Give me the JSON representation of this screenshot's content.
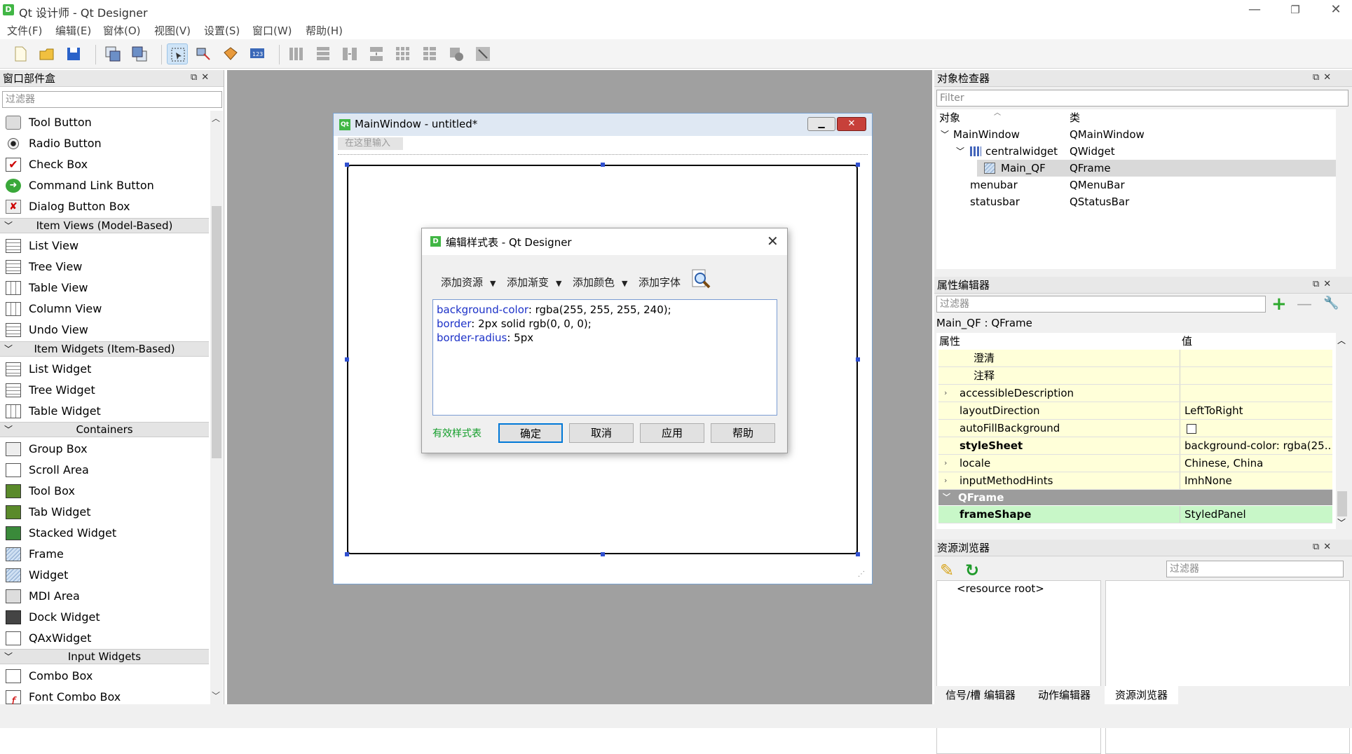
{
  "app": {
    "title": "Qt 设计师 - Qt Designer",
    "icon_letter": "D"
  },
  "window_controls": {
    "minimize": "—",
    "restore": "❐",
    "close": "✕"
  },
  "menus": [
    "文件(F)",
    "编辑(E)",
    "窗体(O)",
    "视图(V)",
    "设置(S)",
    "窗口(W)",
    "帮助(H)"
  ],
  "widget_box": {
    "title": "窗口部件盒",
    "filter_placeholder": "过滤器",
    "items_buttons": [
      "Tool Button",
      "Radio Button",
      "Check Box",
      "Command Link Button",
      "Dialog Button Box"
    ],
    "cat_item_views": "Item Views (Model-Based)",
    "items_views": [
      "List View",
      "Tree View",
      "Table View",
      "Column View",
      "Undo View"
    ],
    "cat_item_widgets": "Item Widgets (Item-Based)",
    "items_widgets": [
      "List Widget",
      "Tree Widget",
      "Table Widget"
    ],
    "cat_containers": "Containers",
    "items_containers": [
      "Group Box",
      "Scroll Area",
      "Tool Box",
      "Tab Widget",
      "Stacked Widget",
      "Frame",
      "Widget",
      "MDI Area",
      "Dock Widget",
      "QAxWidget"
    ],
    "cat_input": "Input Widgets",
    "items_input": [
      "Combo Box",
      "Font Combo Box"
    ]
  },
  "form": {
    "title": "MainWindow - untitled*",
    "qt_badge": "Qt",
    "menu_placeholder": "在这里输入"
  },
  "dialog": {
    "title": "编辑样式表 - Qt Designer",
    "add_resource": "添加资源",
    "add_gradient": "添加渐变",
    "add_color": "添加颜色",
    "add_font": "添加字体",
    "css": [
      {
        "prop": "background-color",
        "value": ": rgba(255, 255, 255, 240);"
      },
      {
        "prop": "border",
        "value": ": 2px solid rgb(0, 0, 0);"
      },
      {
        "prop": "border-radius",
        "value": ": 5px"
      }
    ],
    "valid_text": "有效样式表",
    "ok": "确定",
    "cancel": "取消",
    "apply": "应用",
    "help": "帮助"
  },
  "object_inspector": {
    "title": "对象检查器",
    "filter_placeholder": "Filter",
    "col_object": "对象",
    "col_class": "类",
    "rows": [
      {
        "name": "MainWindow",
        "cls": "QMainWindow"
      },
      {
        "name": "centralwidget",
        "cls": "QWidget"
      },
      {
        "name": "Main_QF",
        "cls": "QFrame"
      },
      {
        "name": "menubar",
        "cls": "QMenuBar"
      },
      {
        "name": "statusbar",
        "cls": "QStatusBar"
      }
    ]
  },
  "property_editor": {
    "title": "属性编辑器",
    "filter_placeholder": "过滤器",
    "object_label": "Main_QF : QFrame",
    "col_prop": "属性",
    "col_value": "值",
    "rows": [
      {
        "name": "澄清",
        "value": ""
      },
      {
        "name": "注释",
        "value": ""
      },
      {
        "name": "accessibleDescription",
        "value": ""
      },
      {
        "name": "layoutDirection",
        "value": "LeftToRight"
      },
      {
        "name": "autoFillBackground",
        "value": ""
      },
      {
        "name": "styleSheet",
        "value": "background-color: rgba(25..."
      },
      {
        "name": "locale",
        "value": "Chinese, China"
      },
      {
        "name": "inputMethodHints",
        "value": "ImhNone"
      }
    ],
    "section": "QFrame",
    "cut_row": {
      "name": "frameShape",
      "value": "StyledPanel"
    }
  },
  "resource_browser": {
    "title": "资源浏览器",
    "filter_placeholder": "过滤器",
    "root": "<resource root>"
  },
  "bottom_tabs": [
    "信号/槽 编辑器",
    "动作编辑器",
    "资源浏览器"
  ],
  "colors": {
    "accent": "#0078d7",
    "selection": "#cce4f7",
    "prop_yellow": "#ffffd9",
    "section_gray": "#9c9c9c",
    "valid_green": "#129d29"
  }
}
